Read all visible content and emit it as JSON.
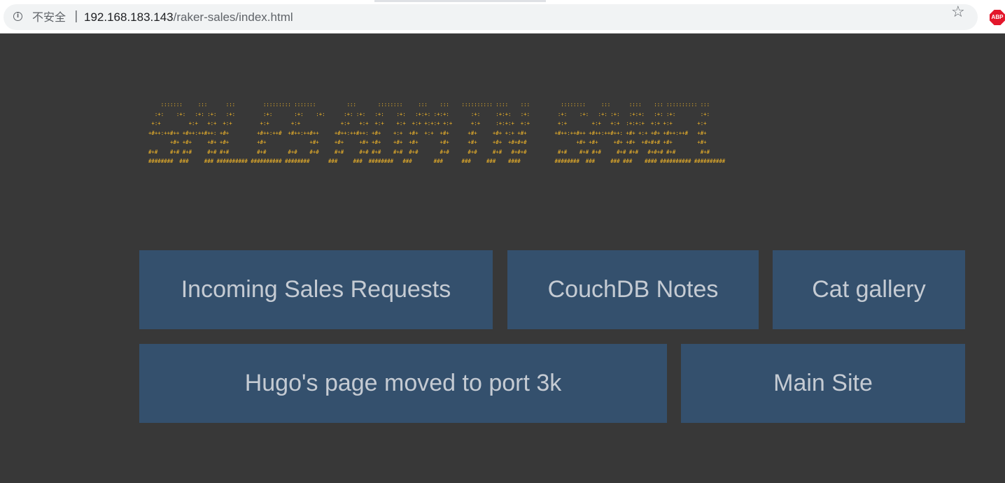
{
  "browser": {
    "security_label": "不安全",
    "separator": "|",
    "url_host": "192.168.183.143",
    "url_path": "/raker-sales/index.html",
    "star_glyph": "☆",
    "extension_label": "ABP"
  },
  "banner": {
    "ascii_art": "    :::::::     :::      :::         ::::::::: :::::::          :::       ::::::::     :::    :::    :::::::::: ::::    :::          ::::::::     :::      ::::    ::: :::::::::: :::\n  :+:    :+:   :+: :+:   :+:         :+:       :+:    :+:      :+: :+:   :+:    :+:   :+:+: :+:+:       :+:     :+:+:   :+:         :+:    :+:   :+: :+:   :+:+:   :+: :+:        :+:\n +:+         +:+   +:+  +:+         +:+       +:+             +:+   +:+  +:+    +:+  +:+ +:+:+ +:+      +:+     :+:+:+  +:+         +:+        +:+   +:+  :+:+:+  +:+ +:+        +:+\n+#++:++#++ +#++:++#++: +#+         +#++:++#  +#++:++#++     +#++:++#++: +#+    +:+  +#+  +:+  +#+      +#+     +#+ +:+ +#+         +#++:++#++ +#++:++#++: +#+ +:+ +#+ +#++:++#   +#+\n       +#+ +#+     +#+ +#+         +#+              +#+     +#+     +#+ +#+    +#+  +#+       +#+      +#+     +#+  +#+#+#                +#+ +#+     +#+ +#+  +#+#+# +#+        +#+\n#+#    #+# #+#     #+# #+#         #+#       #+#    #+#     #+#     #+# #+#    #+#  #+#       #+#      #+#     #+#   #+#+#          #+#    #+# #+#     #+# #+#   #+#+# #+#        #+#\n########  ###     ### ########## ########## ########      ###     ###  ########   ###       ###      ###     ###    ####           ########  ###     ### ###    #### ########## ##########"
  },
  "nav": {
    "incoming_sales": "Incoming Sales Requests",
    "couchdb_notes": "CouchDB Notes",
    "cat_gallery": "Cat gallery",
    "hugos_page": "Hugo's page moved to port 3k",
    "main_site": "Main Site"
  },
  "colors": {
    "page_background": "#383838",
    "button_background": "#34506d",
    "button_text": "#c5cbd3",
    "ascii_art": "#f5b829"
  }
}
